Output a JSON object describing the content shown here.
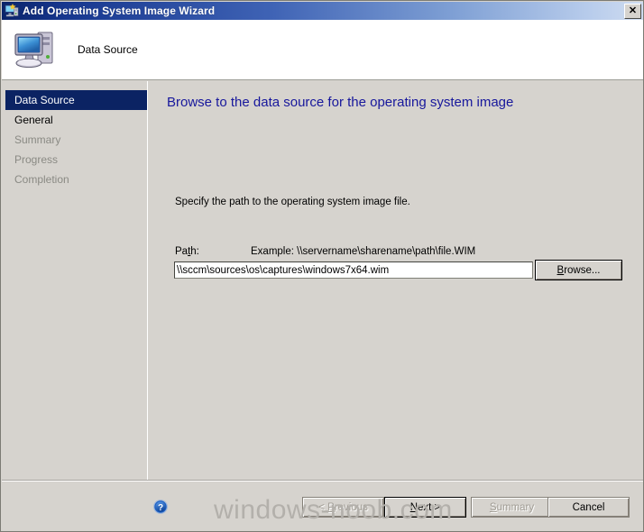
{
  "window": {
    "title": "Add Operating System Image Wizard",
    "title_icon": "wizard-computer-icon",
    "close_label": "✕"
  },
  "header": {
    "icon": "computer-monitor-icon",
    "title": "Data Source"
  },
  "sidebar": {
    "items": [
      {
        "label": "Data Source",
        "state": "selected"
      },
      {
        "label": "General",
        "state": "enabled"
      },
      {
        "label": "Summary",
        "state": "disabled"
      },
      {
        "label": "Progress",
        "state": "disabled"
      },
      {
        "label": "Completion",
        "state": "disabled"
      }
    ]
  },
  "content": {
    "heading": "Browse to the data source for the operating system image",
    "instruction": "Specify the path to the operating system image file.",
    "path_label_pre": "Pa",
    "path_label_acc": "t",
    "path_label_post": "h:",
    "path_example": "Example: \\\\servername\\sharename\\path\\file.WIM",
    "path_value": "\\\\sccm\\sources\\os\\captures\\windows7x64.wim",
    "path_placeholder": "",
    "browse_pre": "",
    "browse_acc": "B",
    "browse_post": "rowse..."
  },
  "footer": {
    "help_icon": "help-question-icon",
    "buttons": [
      {
        "name": "previous",
        "pre": "< ",
        "acc": "P",
        "post": "revious",
        "state": "disabled"
      },
      {
        "name": "next",
        "pre": "",
        "acc": "N",
        "post": "ext >",
        "state": "default"
      },
      {
        "name": "summary",
        "pre": "",
        "acc": "S",
        "post": "ummary",
        "state": "disabled"
      },
      {
        "name": "cancel",
        "pre": "",
        "acc": "",
        "post": "Cancel",
        "state": "enabled"
      }
    ]
  },
  "watermark": {
    "text": "windows-noob.com"
  },
  "colors": {
    "titlebar_dark": "#0a246a",
    "titlebar_light": "#cfdcf0",
    "dialog_face": "#d6d3ce",
    "selection": "#0b2363",
    "heading": "#17179c",
    "disabled_text": "#8a8a84",
    "watermark": "#b3b0ab"
  }
}
